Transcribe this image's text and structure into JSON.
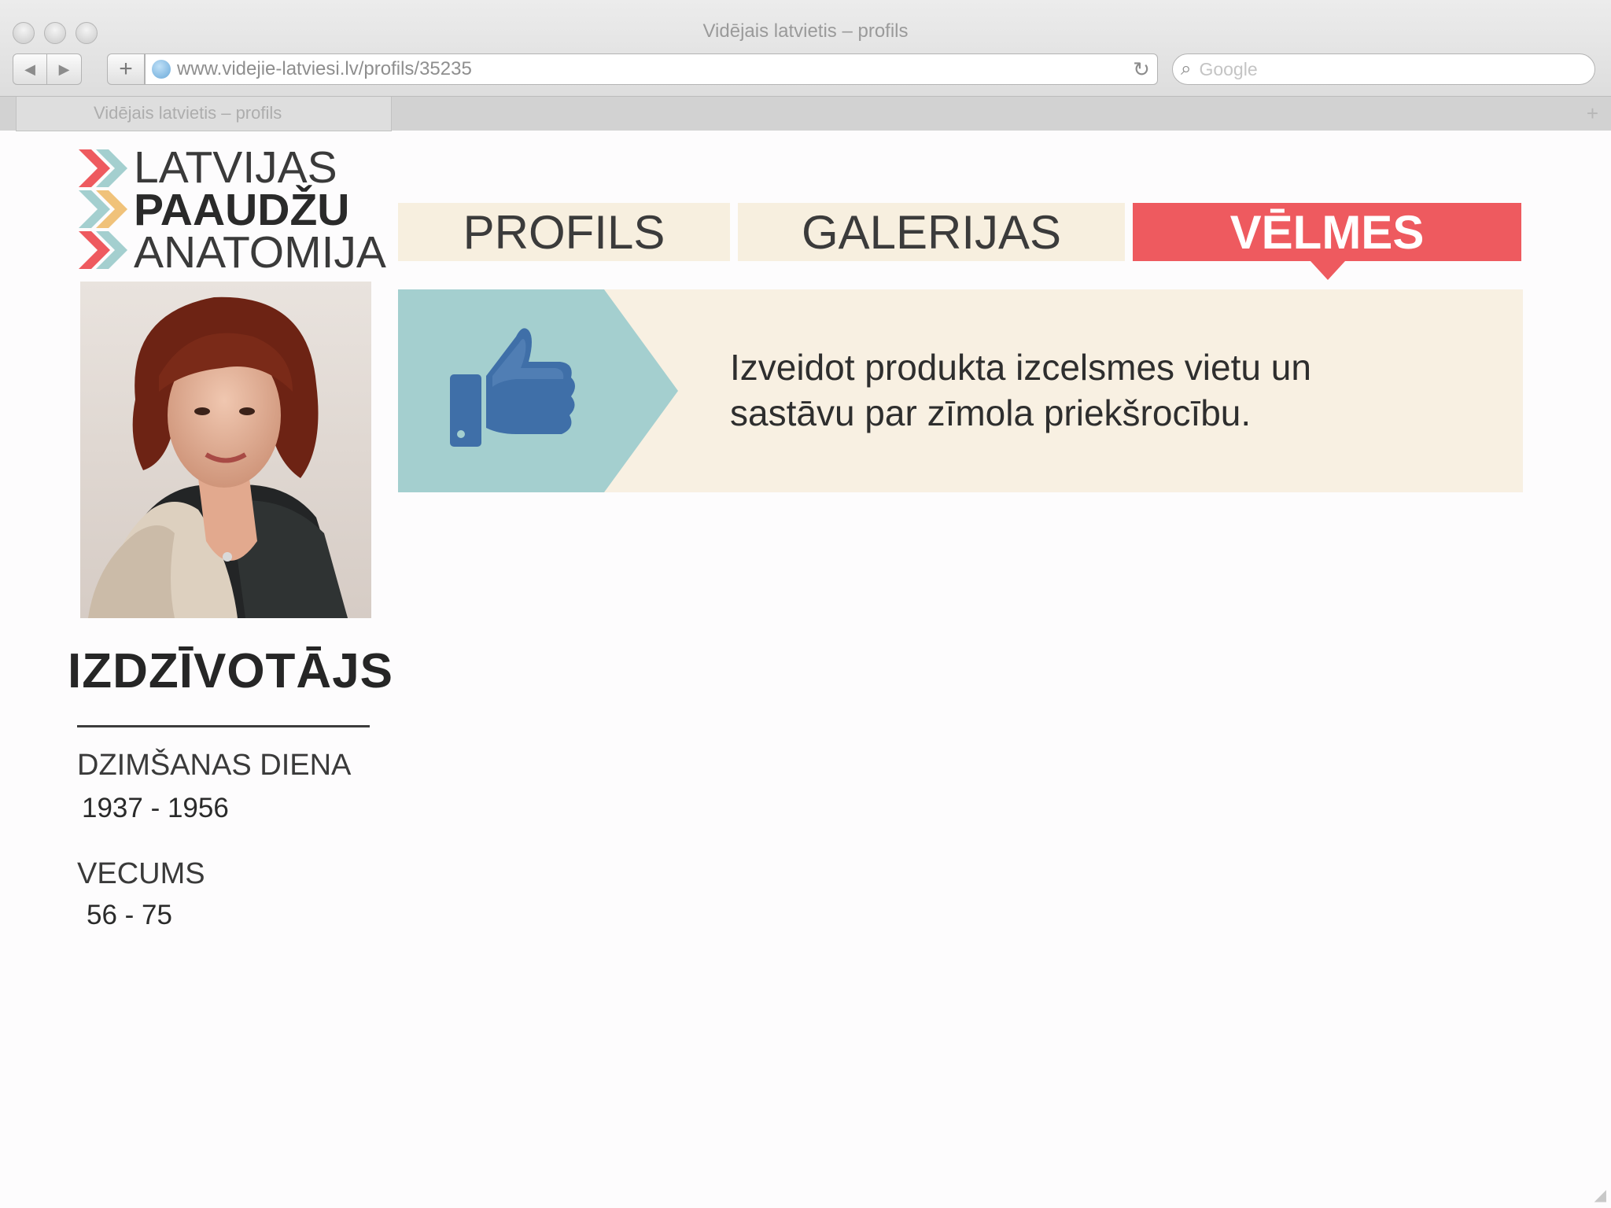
{
  "window": {
    "title": "Vidējais latvietis – profils"
  },
  "toolbar": {
    "url": "www.videjie-latviesi.lv/profils/35235",
    "search_placeholder": "Google"
  },
  "tabstrip": {
    "active_tab": "Vidējais latvietis – profils"
  },
  "logo": {
    "line1": "LATVIJAS",
    "line2": "PAAUDŽU",
    "line3": "ANATOMIJA"
  },
  "profile": {
    "persona": "IZDZĪVOTĀJS",
    "birth_label": "DZIMŠANAS DIENA",
    "birth_value": "1937 - 1956",
    "age_label": "VECUMS",
    "age_value": "56 - 75"
  },
  "nav": {
    "tabs": [
      {
        "label": "PROFILS",
        "active": false
      },
      {
        "label": "GALERIJAS",
        "active": false
      },
      {
        "label": "VĒLMES",
        "active": true
      }
    ]
  },
  "content": {
    "icon": "thumbs-up-icon",
    "text": "Izveidot produkta izcelsmes vietu un sastāvu par zīmola priekšrocību."
  },
  "colors": {
    "accent": "#ee5a5f",
    "tab_bg": "#f7efdf",
    "panel_bg": "#f8f0e2",
    "chevron": "#a4cfcf",
    "thumb": "#3f6fa8"
  }
}
